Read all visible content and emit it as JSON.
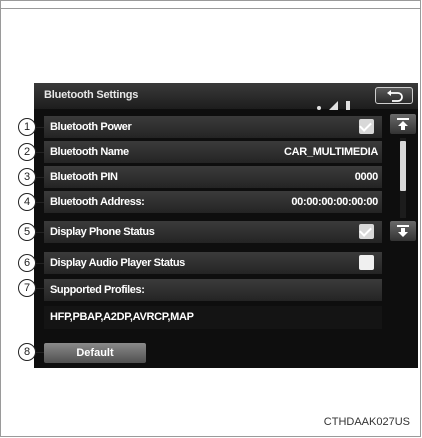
{
  "screen": {
    "title": "Bluetooth Settings",
    "rows": [
      {
        "num": "1",
        "label": "Bluetooth Power",
        "value": "",
        "control": "checkbox",
        "checked": true
      },
      {
        "num": "2",
        "label": "Bluetooth Name",
        "value": "CAR_MULTIMEDIA",
        "control": "text"
      },
      {
        "num": "3",
        "label": "Bluetooth PIN",
        "value": "0000",
        "control": "text"
      },
      {
        "num": "4",
        "label": "Bluetooth Address:",
        "value": "00:00:00:00:00:00",
        "control": "text"
      },
      {
        "num": "5",
        "label": "Display Phone Status",
        "value": "",
        "control": "checkbox",
        "checked": true
      },
      {
        "num": "6",
        "label": "Display Audio Player Status",
        "value": "",
        "control": "checkbox",
        "checked": false
      },
      {
        "num": "7",
        "label": "Supported Profiles:",
        "value": "",
        "control": "none"
      }
    ],
    "profiles": "HFP,PBAP,A2DP,AVRCP,MAP",
    "default_button": {
      "num": "8",
      "label": "Default"
    }
  },
  "figure_code": "CTHDAAK027US",
  "icons": [
    "bluetooth-status-icon",
    "signal-bars-icon",
    "battery-icon",
    "back-arrow-icon",
    "scroll-up-icon",
    "scroll-down-icon",
    "checkmark-icon"
  ],
  "colors": {
    "screen_bg": "#0e0e0e",
    "row_bg": "#2e2e2e",
    "checkbox": "#d8d8d8",
    "text": "#ffffff"
  }
}
